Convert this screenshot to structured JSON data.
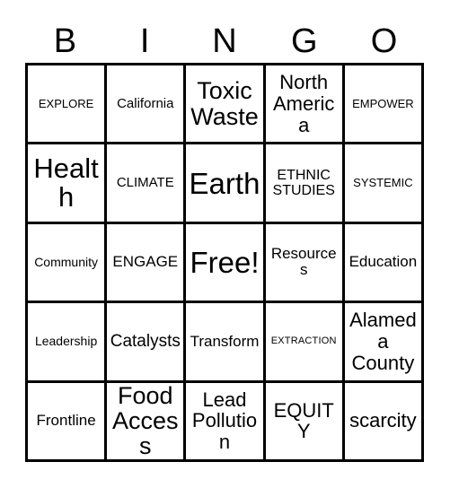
{
  "card": {
    "type": "bingo-card",
    "columns": 5,
    "rows": 5,
    "free_space": "Free!",
    "background_color": "#ffffff",
    "text_color": "#000000",
    "border_color": "#000000"
  },
  "header": {
    "letters": [
      "B",
      "I",
      "N",
      "G",
      "O"
    ]
  },
  "grid": {
    "cells": [
      {
        "text": "EXPLORE",
        "row": 1,
        "col": 1,
        "size": "fs-xs"
      },
      {
        "text": "California",
        "row": 1,
        "col": 2,
        "size": "fs-sm"
      },
      {
        "text": "Toxic Waste",
        "row": 1,
        "col": 3,
        "size": "fs-xxl"
      },
      {
        "text": "North America",
        "row": 1,
        "col": 4,
        "size": "fs-xl"
      },
      {
        "text": "EMPOWER",
        "row": 1,
        "col": 5,
        "size": "fs-xs"
      },
      {
        "text": "Health",
        "row": 2,
        "col": 1,
        "size": "fs-3xl"
      },
      {
        "text": "CLIMATE",
        "row": 2,
        "col": 2,
        "size": "fs-sm"
      },
      {
        "text": "Earth",
        "row": 2,
        "col": 3,
        "size": "fs-4xl"
      },
      {
        "text": "ETHNIC STUDIES",
        "row": 2,
        "col": 4,
        "size": "fs-m"
      },
      {
        "text": "SYSTEMIC",
        "row": 2,
        "col": 5,
        "size": "fs-xs"
      },
      {
        "text": "Community",
        "row": 3,
        "col": 1,
        "size": "fs-s"
      },
      {
        "text": "ENGAGE",
        "row": 3,
        "col": 2,
        "size": "fs-ml"
      },
      {
        "text": "Free!",
        "row": 3,
        "col": 3,
        "size": "fs-4xl"
      },
      {
        "text": "Resources",
        "row": 3,
        "col": 4,
        "size": "fs-ml"
      },
      {
        "text": "Education",
        "row": 3,
        "col": 5,
        "size": "fs-ml"
      },
      {
        "text": "Leadership",
        "row": 4,
        "col": 1,
        "size": "fs-s"
      },
      {
        "text": "Catalysts",
        "row": 4,
        "col": 2,
        "size": "fs-l"
      },
      {
        "text": "Transform",
        "row": 4,
        "col": 3,
        "size": "fs-ml"
      },
      {
        "text": "EXTRACTION",
        "row": 4,
        "col": 4,
        "size": "fs-xxs"
      },
      {
        "text": "Alameda County",
        "row": 4,
        "col": 5,
        "size": "fs-xl"
      },
      {
        "text": "Frontline",
        "row": 5,
        "col": 1,
        "size": "fs-ml"
      },
      {
        "text": "Food Access",
        "row": 5,
        "col": 2,
        "size": "fs-xxl"
      },
      {
        "text": "Lead Pollution",
        "row": 5,
        "col": 3,
        "size": "fs-xl"
      },
      {
        "text": "EQUITY",
        "row": 5,
        "col": 4,
        "size": "fs-xl"
      },
      {
        "text": "scarcity",
        "row": 5,
        "col": 5,
        "size": "fs-xl"
      }
    ]
  }
}
